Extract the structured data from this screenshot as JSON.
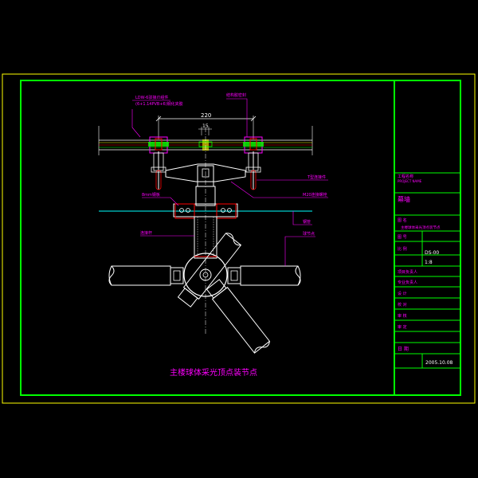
{
  "drawing": {
    "caption": "主楼球体采光顶点装节点",
    "dimensions": {
      "overall": "220",
      "spacing": "15"
    },
    "callouts": {
      "top_left_line1": "LDW-6驳接爪组件",
      "top_left_line2": "(6+1.14PVB+6)钢化夹胶",
      "top_right": "结构胶密封",
      "right_1": "T型连接件",
      "right_2": "M20连接螺栓",
      "right_3": "钢管",
      "right_4": "球节点",
      "left_1": "8mm钢板",
      "left_2": "连接杆"
    }
  },
  "title_block": {
    "company_cn": "工程名称",
    "company_en": "PROJECT NAME",
    "project": "幕墙",
    "rows": [
      {
        "label": "图  名",
        "value": "主楼球体采光顶点装节点"
      },
      {
        "label": "图  号",
        "value": "DS-00"
      },
      {
        "label": "比  例",
        "value": "1:8"
      },
      {
        "label": "项目负责人",
        "value": ""
      },
      {
        "label": "专业负责人",
        "value": ""
      },
      {
        "label": "设  计",
        "value": ""
      },
      {
        "label": "校  对",
        "value": ""
      },
      {
        "label": "审  核",
        "value": ""
      },
      {
        "label": "审  定",
        "value": ""
      },
      {
        "label": "日  期",
        "value": "2005.10.08"
      }
    ]
  },
  "colors": {
    "border_outer": "#ffff00",
    "border_inner": "#00ff00",
    "callout": "#ff00ff",
    "glass": "#00ffff",
    "steel": "#ffffff",
    "bolt": "#ff0000",
    "rail": "#ffff00"
  }
}
